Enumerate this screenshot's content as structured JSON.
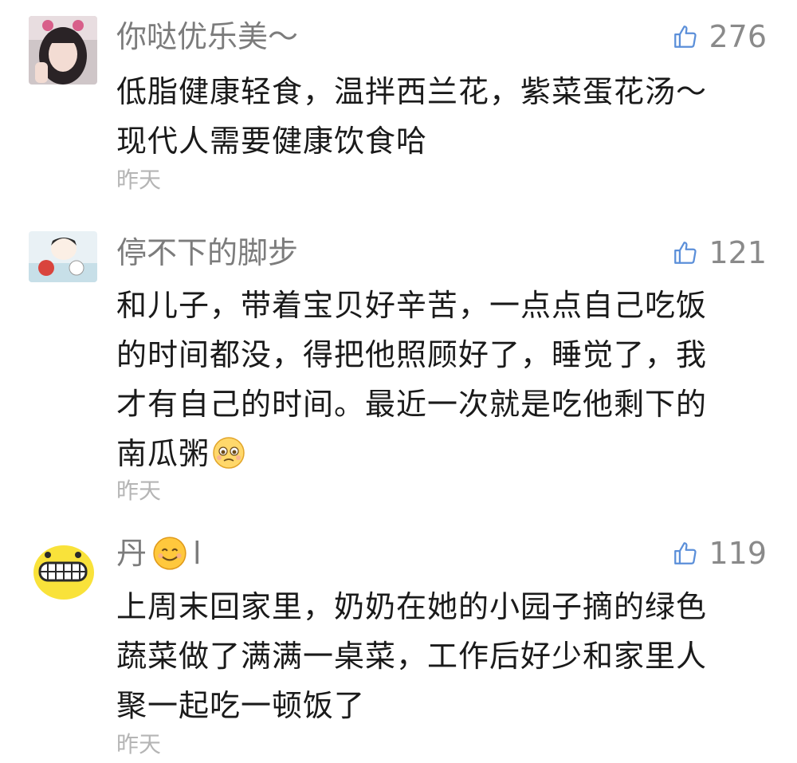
{
  "comments": [
    {
      "username": "你哒优乐美～",
      "likes": "276",
      "lines": [
        "低脂健康轻食，温拌西兰花，紫菜蛋花汤～",
        "现代人需要健康饮食哈"
      ],
      "time": "昨天"
    },
    {
      "username": "停不下的脚步",
      "likes": "121",
      "lines": [
        "和儿子，带着宝贝好辛苦，一点点自己吃饭",
        "的时间都没，得把他照顾好了，睡觉了，我",
        "才有自己的时间。最近一次就是吃他剩下的",
        "南瓜粥"
      ],
      "time": "昨天"
    },
    {
      "username_prefix": "丹",
      "username_suffix": "l",
      "likes": "119",
      "lines": [
        "上周末回家里，奶奶在她的小园子摘的绿色",
        "蔬菜做了满满一桌菜，工作后好少和家里人",
        "聚一起吃一顿饭了"
      ],
      "time": "昨天"
    }
  ],
  "colors": {
    "username": "#7c7c7c",
    "body_text": "#1a1a1a",
    "timestamp": "#b5b5b5",
    "like_icon": "#5b8fd9"
  },
  "icons": [
    "thumbs-up-icon",
    "pleading-face-emoji",
    "smiling-face-emoji"
  ]
}
